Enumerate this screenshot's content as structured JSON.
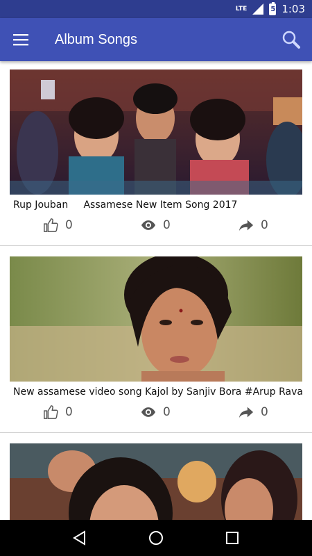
{
  "status_bar": {
    "network": "LTE",
    "battery_level": "5",
    "time": "1:03"
  },
  "app_bar": {
    "title": "Album Songs"
  },
  "videos": [
    {
      "title": "Rup Jouban     Assamese New Item Song 2017",
      "likes": "0",
      "views": "0",
      "shares": "0"
    },
    {
      "title": "New assamese video song Kajol by Sanjiv Bora #Arup Rava",
      "likes": "0",
      "views": "0",
      "shares": "0"
    },
    {
      "title": "",
      "likes": "",
      "views": "",
      "shares": ""
    }
  ],
  "colors": {
    "status_bar": "#2e3d8f",
    "app_bar": "#3f51b5",
    "nav_bar": "#000000",
    "icon_gray": "#555555"
  },
  "icons": [
    "menu-icon",
    "search-icon",
    "thumbs-up-icon",
    "eye-icon",
    "share-icon",
    "back-icon",
    "home-icon",
    "recents-icon"
  ]
}
